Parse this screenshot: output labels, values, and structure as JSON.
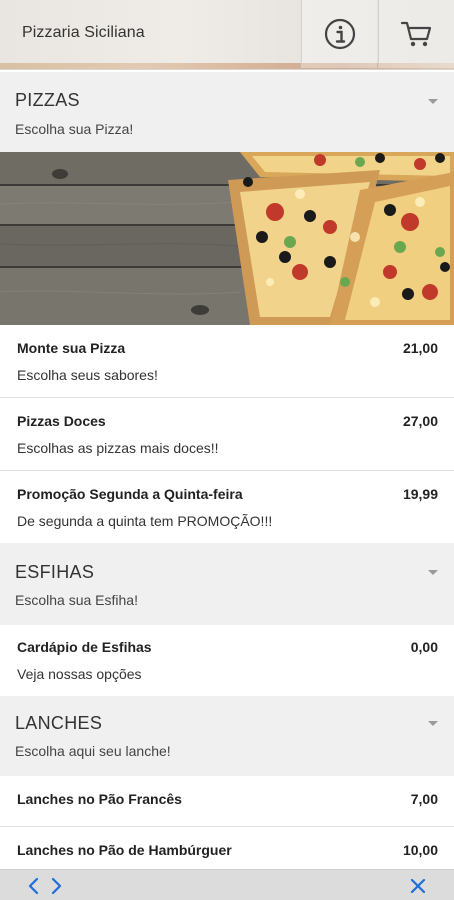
{
  "header": {
    "title": "Pizzaria Siciliana",
    "info_icon": "info-icon",
    "cart_icon": "cart-icon"
  },
  "categories": [
    {
      "title": "PIZZAS",
      "subtitle": "Escolha sua Pizza!",
      "items": [
        {
          "name": "Monte sua Pizza",
          "price": "21,00",
          "description": "Escolha seus sabores!"
        },
        {
          "name": "Pizzas Doces",
          "price": "27,00",
          "description": "Escolhas as pizzas mais doces!!"
        },
        {
          "name": "Promoção Segunda a Quinta-feira",
          "price": "19,99",
          "description": "De segunda a quinta tem PROMOÇÃO!!!"
        }
      ]
    },
    {
      "title": "ESFIHAS",
      "subtitle": "Escolha sua Esfiha!",
      "items": [
        {
          "name": "Cardápio de Esfihas",
          "price": "0,00",
          "description": "Veja nossas opções"
        }
      ]
    },
    {
      "title": "LANCHES",
      "subtitle": "Escolha aqui seu lanche!",
      "items": [
        {
          "name": "Lanches no Pão Francês",
          "price": "7,00"
        },
        {
          "name": "Lanches no Pão de Hambúrguer",
          "price": "10,00"
        }
      ]
    }
  ],
  "bottom_bar": {
    "back_icon": "chevron-left-icon",
    "forward_icon": "chevron-right-icon",
    "close_icon": "close-icon"
  },
  "colors": {
    "accent_blue": "#1e6fd9",
    "category_bg": "#f0f0f0"
  }
}
